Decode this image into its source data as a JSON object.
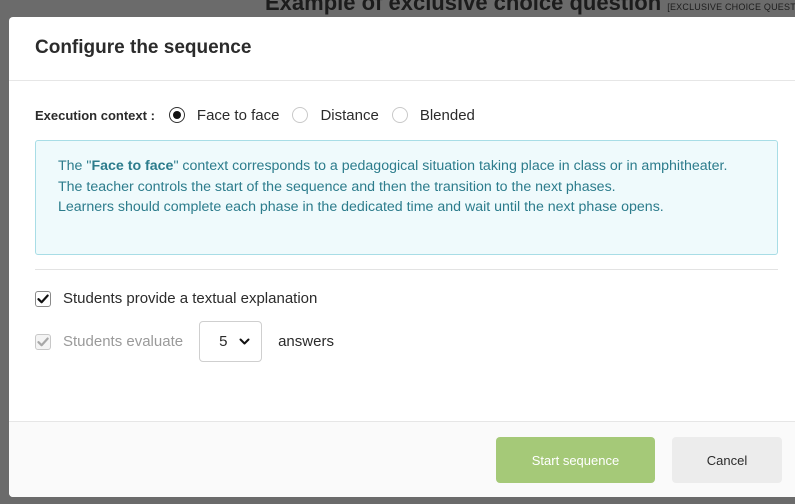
{
  "background": {
    "title": "Example of exclusive choice question",
    "title_tag": "[EXCLUSIVE CHOICE QUESTION]"
  },
  "modal": {
    "title": "Configure the sequence",
    "execution_context": {
      "label": "Execution context :",
      "options": [
        {
          "label": "Face to face",
          "checked": true
        },
        {
          "label": "Distance",
          "checked": false
        },
        {
          "label": "Blended",
          "checked": false
        }
      ]
    },
    "info": {
      "line1_prefix": "The \"",
      "line1_bold": "Face to face",
      "line1_suffix": "\" context corresponds to a pedagogical situation taking place in class or in amphitheater.",
      "line2": "The teacher controls the start of the sequence and then the transition to the next phases.",
      "line3": "Learners should complete each phase in the dedicated time and wait until the next phase opens."
    },
    "textual_explanation": {
      "label": "Students provide a textual explanation",
      "checked": true
    },
    "evaluate": {
      "label": "Students evaluate",
      "checked": true,
      "disabled": true,
      "count_value": "5",
      "suffix": "answers"
    },
    "footer": {
      "start_label": "Start sequence",
      "cancel_label": "Cancel"
    }
  },
  "colors": {
    "info_text": "#2c7c8c",
    "info_bg": "#effafc",
    "info_border": "#a8dde6",
    "start_button": "#a5c978",
    "cancel_button": "#ececec"
  }
}
